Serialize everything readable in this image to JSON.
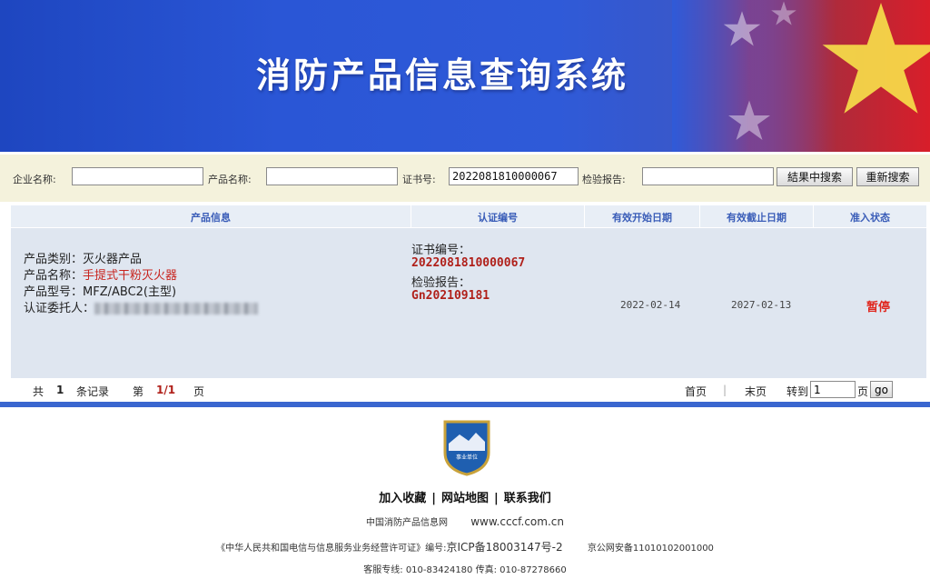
{
  "header": {
    "title": "消防产品信息查询系统"
  },
  "search": {
    "company_label": "企业名称:",
    "company_value": "",
    "product_label": "产品名称:",
    "product_value": "",
    "cert_label": "证书号:",
    "cert_value": "2022081810000067",
    "report_label": "检验报告:",
    "report_value": "",
    "search_in_results_label": "結果中搜索",
    "new_search_label": "重新搜索"
  },
  "table": {
    "headers": {
      "product_info": "产品信息",
      "cert_number": "认证编号",
      "valid_start": "有效开始日期",
      "valid_end": "有效截止日期",
      "admission_status": "准入状态"
    },
    "rows": [
      {
        "category_label": "产品类别：",
        "category_value": "灭火器产品",
        "name_label": "产品名称：",
        "name_value": "手提式干粉灭火器",
        "model_label": "产品型号：",
        "model_value": "MFZ/ABC2(主型)",
        "client_label": "认证委托人：",
        "cert_no_label": "证书编号：",
        "cert_no_value": "2022081810000067",
        "report_label": "检验报告：",
        "report_value": "Gn202109181",
        "valid_start": "2022-02-14",
        "valid_end": "2027-02-13",
        "status": "暂停"
      }
    ]
  },
  "pager": {
    "total_prefix": "共",
    "total_count": "1",
    "total_suffix": "条记录",
    "page_prefix": "第",
    "page_current": "1/1",
    "page_suffix": "页",
    "first_label": "首页",
    "last_label": "末页",
    "goto_label": "转到",
    "goto_value": "1",
    "goto_suffix": "页",
    "go_label": "go"
  },
  "footer": {
    "emblem_text": "事业单位",
    "link_favorite": "加入收藏",
    "link_sitemap": "网站地图",
    "link_contact": "联系我们",
    "site_name": "中国消防产品信息网",
    "site_url": "www.cccf.com.cn",
    "license_text": "《中华人民共和国电信与信息服务业务经营许可证》编号:",
    "icp": "京ICP备18003147号-2",
    "police_record": "京公网安备11010102001000",
    "service_phone": "客服专线: 010-83424180 传真: 010-87278660"
  },
  "colors": {
    "banner_blue": "#2a56d6",
    "status_red": "#e0261d",
    "cert_red": "#b0201a",
    "header_blue": "#3a5db8"
  }
}
